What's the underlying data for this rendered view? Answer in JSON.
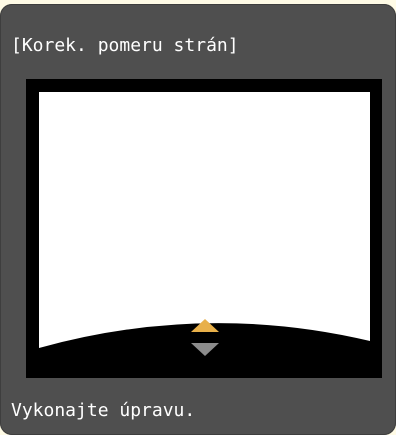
{
  "dialog": {
    "title": "[Korek. pomeru strán]",
    "message": "Vykonajte úpravu."
  },
  "preview": {
    "screen_color": "#ffffff",
    "frame_color": "#000000",
    "active_handle": "arrow-up-icon",
    "active_color": "#e8b04a",
    "inactive_handle": "arrow-down-icon",
    "inactive_color": "#8c8c8c"
  },
  "colors": {
    "panel_background": "#4f4f4f",
    "page_background": "#fffbe6",
    "text": "#ffffff"
  }
}
